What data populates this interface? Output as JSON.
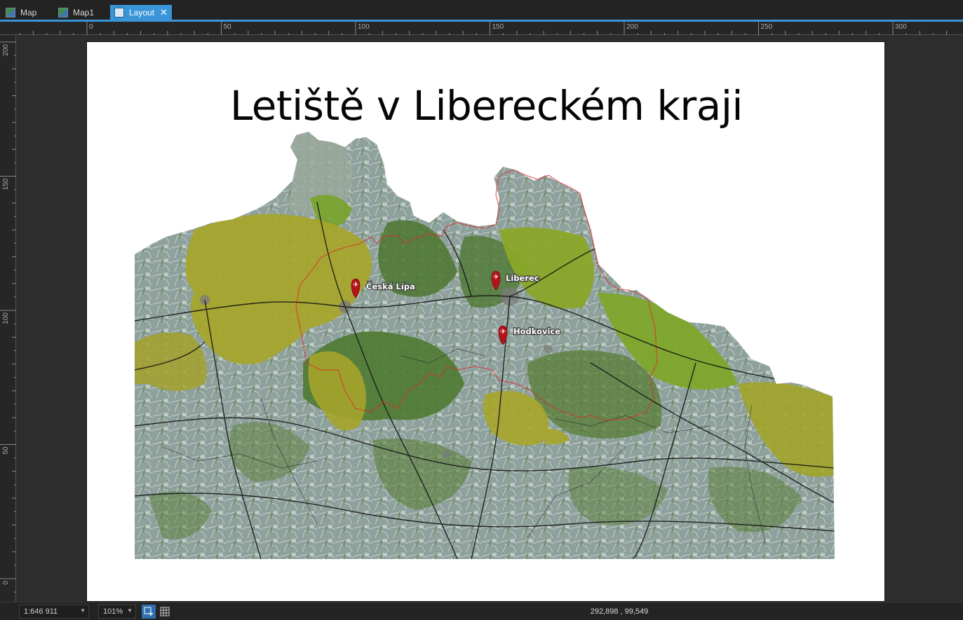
{
  "tabs": [
    {
      "label": "Map",
      "icon": "map-icon"
    },
    {
      "label": "Map1",
      "icon": "map-icon"
    },
    {
      "label": "Layout",
      "icon": "layout-icon",
      "active": true
    }
  ],
  "ruler": {
    "horizontal_labels": [
      "0",
      "50",
      "100",
      "150",
      "200",
      "250",
      "300"
    ],
    "vertical_labels": [
      "200",
      "150",
      "100",
      "50",
      "0"
    ]
  },
  "layout": {
    "title": "Letiště v Libereckém kraji",
    "airports": [
      {
        "label": "Česká Lípa",
        "icon": "airport-marker-icon"
      },
      {
        "label": "Liberec",
        "icon": "airport-marker-icon"
      },
      {
        "label": "Hodkovice",
        "icon": "airport-marker-icon"
      }
    ],
    "colors": {
      "forest_dark": "#4f7a32",
      "forest_light": "#88a82a",
      "protected_yellow": "#a7a52a",
      "farmland": "#8e9e9a",
      "roads": "#151515",
      "region_border": "#e0282b",
      "marker": "#b5121b"
    }
  },
  "status": {
    "scale": "1:646 911",
    "zoom": "101%",
    "coordinates": "292,898 , 99,549"
  },
  "theme": {
    "accent": "#3a95d8",
    "background": "#2b2b2b"
  }
}
